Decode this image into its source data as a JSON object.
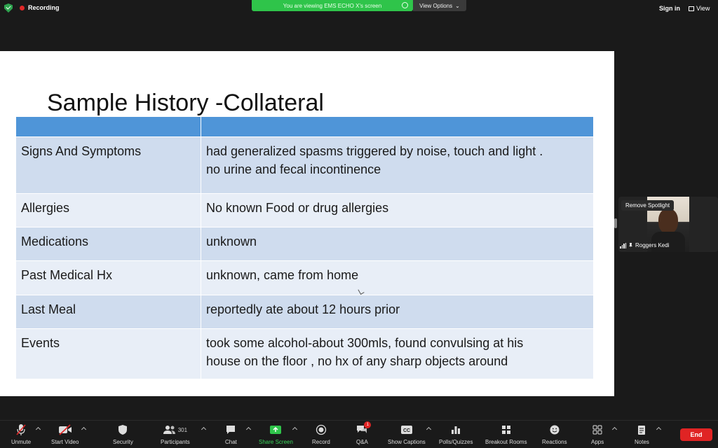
{
  "topbar": {
    "recording_label": "Recording",
    "viewing_banner": "You are viewing EMS ECHO X's screen",
    "view_options_label": "View Options",
    "signin_label": "Sign in",
    "view_label": "View"
  },
  "slide": {
    "title": "Sample History -Collateral",
    "rows": [
      {
        "label": "Signs And Symptoms",
        "value_line1": "had generalized spasms triggered by noise, touch and light .",
        "value_line2": "no urine and fecal incontinence"
      },
      {
        "label": "Allergies",
        "value_line1": "No known Food or drug allergies",
        "value_line2": ""
      },
      {
        "label": "Medications",
        "value_line1": "unknown",
        "value_line2": ""
      },
      {
        "label": "Past Medical Hx",
        "value_line1": "unknown, came from home",
        "value_line2": ""
      },
      {
        "label": "Last Meal",
        "value_line1": "reportedly ate about 12 hours prior",
        "value_line2": ""
      },
      {
        "label": "Events",
        "value_line1": "took some alcohol-about 300mls, found convulsing at his",
        "value_line2": "house on the floor , no hx of any sharp objects around"
      }
    ]
  },
  "participant": {
    "spotlight_label": "Remove Spotlight",
    "name": "Roggers Kedi"
  },
  "toolbar": {
    "unmute": "Unmute",
    "start_video": "Start Video",
    "security": "Security",
    "participants": "Participants",
    "participants_count": "301",
    "chat": "Chat",
    "share_screen": "Share Screen",
    "record": "Record",
    "qa": "Q&A",
    "qa_badge": "1",
    "show_captions": "Show Captions",
    "polls": "Polls/Quizzes",
    "breakout": "Breakout Rooms",
    "reactions": "Reactions",
    "apps": "Apps",
    "notes": "Notes",
    "end": "End"
  },
  "colors": {
    "header_blue": "#4f95d8",
    "row_dark": "#cfdcee",
    "row_light": "#e8eef7",
    "share_green": "#2fc44a",
    "end_red": "#e02424"
  }
}
